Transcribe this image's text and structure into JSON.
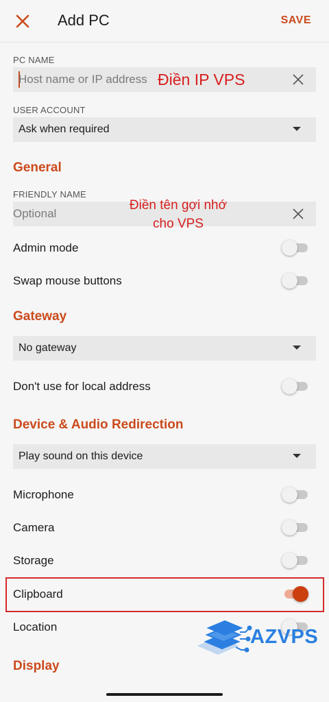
{
  "header": {
    "title": "Add PC",
    "save_label": "SAVE"
  },
  "pc_name": {
    "caption": "PC NAME",
    "placeholder": "Host name or IP address"
  },
  "user_account": {
    "caption": "USER ACCOUNT",
    "value": "Ask when required"
  },
  "general": {
    "heading": "General",
    "friendly_caption": "FRIENDLY NAME",
    "friendly_placeholder": "Optional",
    "admin_mode": "Admin mode",
    "swap_mouse": "Swap mouse buttons"
  },
  "gateway": {
    "heading": "Gateway",
    "value": "No gateway",
    "local_address": "Don't use for local address"
  },
  "device_audio": {
    "heading": "Device & Audio Redirection",
    "sound_value": "Play sound on this device",
    "microphone": "Microphone",
    "camera": "Camera",
    "storage": "Storage",
    "clipboard": "Clipboard",
    "location": "Location"
  },
  "display": {
    "heading": "Display"
  },
  "toggles": {
    "admin_mode": false,
    "swap_mouse": false,
    "local_address": false,
    "microphone": false,
    "camera": false,
    "storage": false,
    "clipboard": true,
    "location": false
  },
  "annotations": {
    "ip_note": "Điền IP VPS",
    "name_note_line1": "Điền tên gợi nhớ",
    "name_note_line2": "cho VPS"
  },
  "watermark": {
    "brand": "AZVPS"
  },
  "colors": {
    "accent": "#cb4a1c",
    "annotation": "#d81e1e",
    "brand": "#2a7fe0"
  }
}
